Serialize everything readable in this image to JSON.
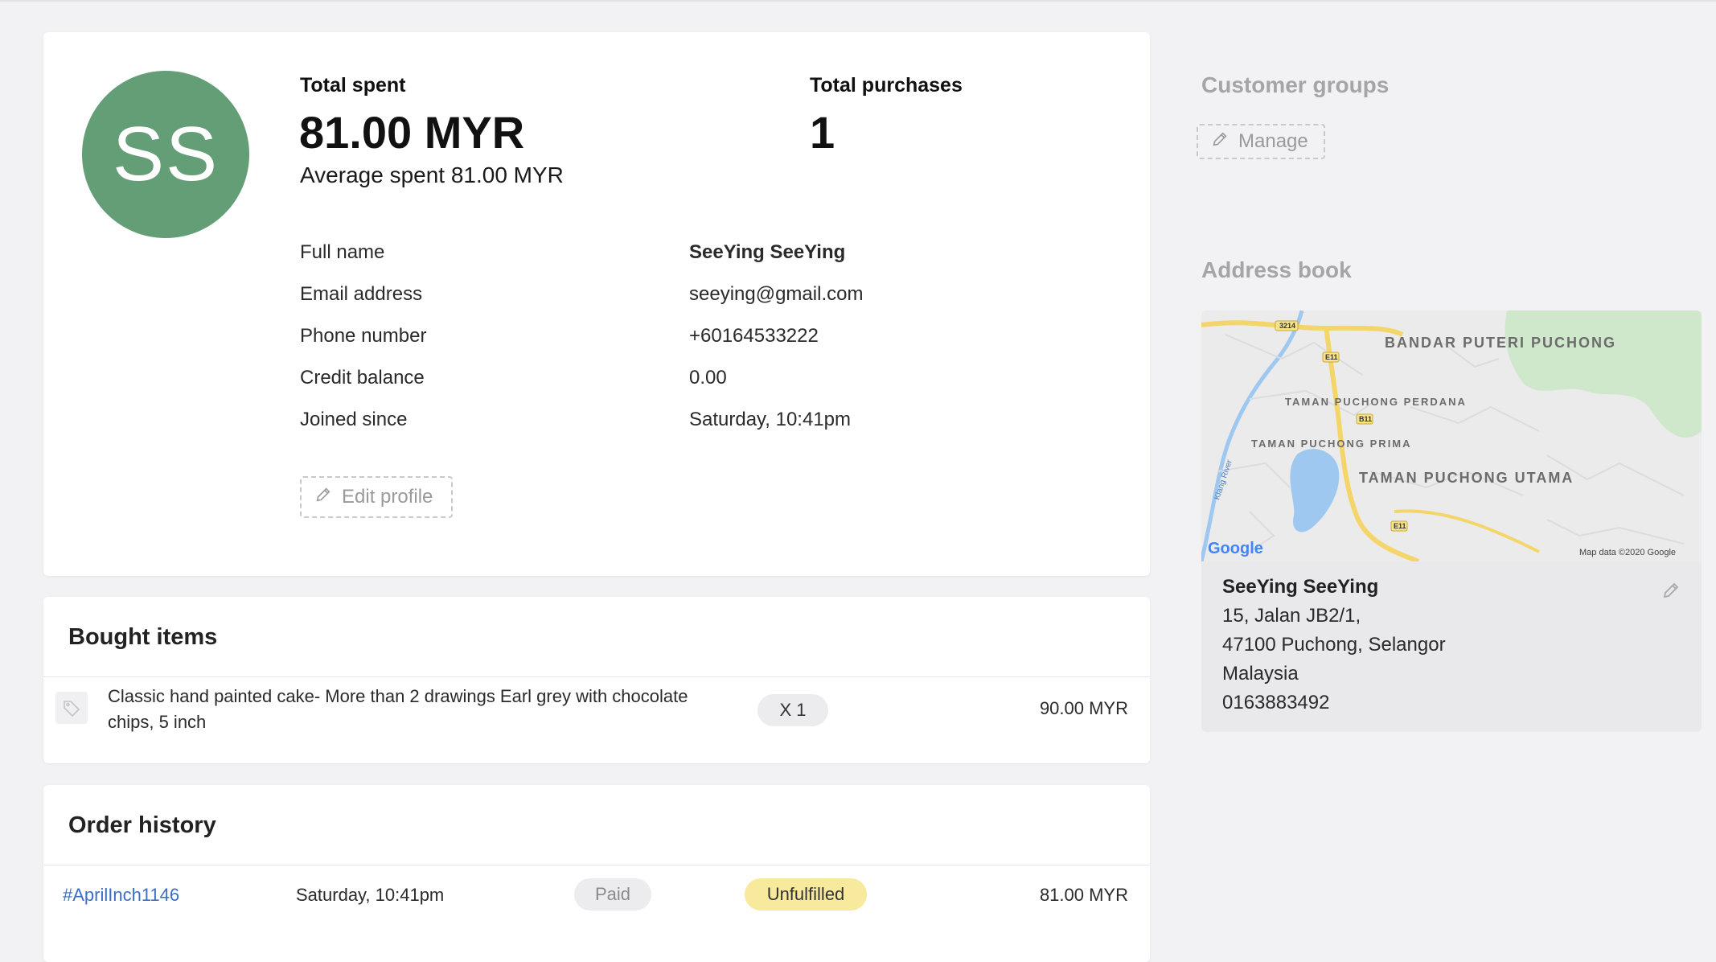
{
  "profile": {
    "initials": "SS",
    "avatar_color": "#649e76",
    "total_spent_label": "Total spent",
    "total_spent_value": "81.00 MYR",
    "average_spent": "Average spent 81.00 MYR",
    "total_purchases_label": "Total purchases",
    "total_purchases_value": "1",
    "details": [
      {
        "label": "Full name",
        "value": "SeeYing SeeYing"
      },
      {
        "label": "Email address",
        "value": "seeying@gmail.com"
      },
      {
        "label": "Phone number",
        "value": "+60164533222"
      },
      {
        "label": "Credit balance",
        "value": "0.00"
      },
      {
        "label": "Joined since",
        "value": "Saturday, 10:41pm"
      }
    ],
    "edit_label": "Edit profile"
  },
  "bought_items": {
    "title": "Bought items",
    "items": [
      {
        "name": "Classic hand painted cake- More than 2 drawings Earl grey with chocolate chips, 5 inch",
        "qty": "X 1",
        "price": "90.00 MYR"
      }
    ]
  },
  "order_history": {
    "title": "Order history",
    "orders": [
      {
        "id": "#AprilInch1146",
        "date": "Saturday, 10:41pm",
        "payment": "Paid",
        "fulfillment": "Unfulfilled",
        "total": "81.00 MYR"
      }
    ]
  },
  "customer_groups": {
    "title": "Customer groups",
    "manage_label": "Manage"
  },
  "address_book": {
    "title": "Address book",
    "map": {
      "labels": {
        "area1": "BANDAR PUTERI PUCHONG",
        "area2": "TAMAN PUCHONG PERDANA",
        "area3": "TAMAN PUCHONG PRIMA",
        "area4": "TAMAN PUCHONG UTAMA",
        "river": "Klang River",
        "road1": "3214",
        "road2": "E11",
        "road3": "B11",
        "road4": "E11",
        "google": "Google",
        "attribution": "Map data ©2020 Google"
      }
    },
    "name": "SeeYing SeeYing",
    "lines": [
      "15, Jalan JB2/1,",
      "47100 Puchong, Selangor",
      "Malaysia",
      "0163883492"
    ]
  }
}
